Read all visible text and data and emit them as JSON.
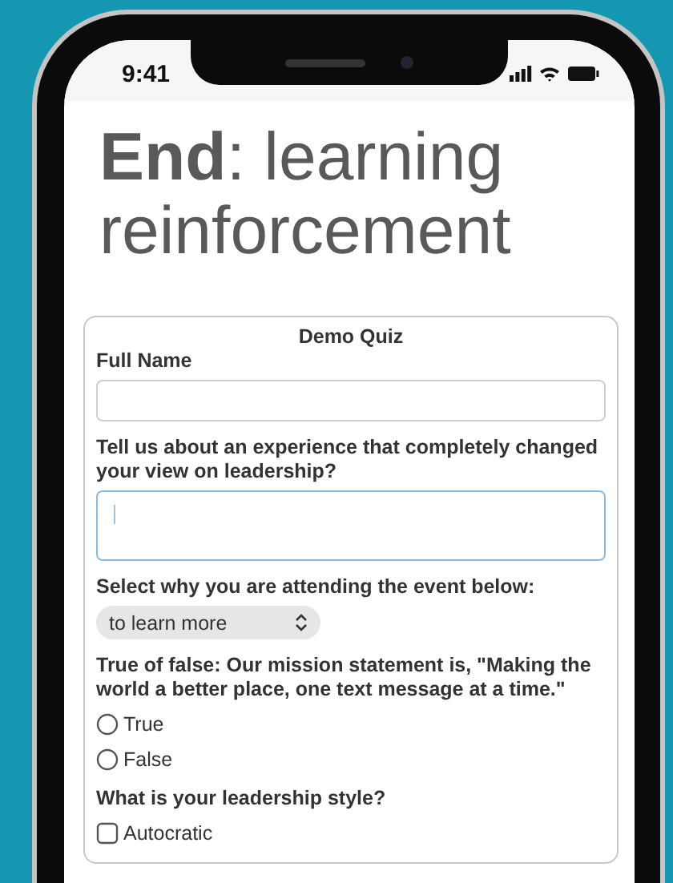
{
  "status_bar": {
    "time": "9:41"
  },
  "heading": "**End**: learning reinforcement",
  "quiz": {
    "title": "Demo Quiz",
    "fields": [
      {
        "kind": "text",
        "label": "Full Name",
        "focused": false
      },
      {
        "kind": "textarea",
        "label": "Tell us about an experience that completely changed your view on leadership?",
        "focused": true
      },
      {
        "kind": "select",
        "label": "Select why you are attending the event below:",
        "value": "to learn more"
      },
      {
        "kind": "radio",
        "label": "True of false: Our mission statement is, \"Making the world a better place, one text message at a time.\"",
        "options": [
          {
            "label": "True",
            "selected": false
          },
          {
            "label": "False",
            "selected": false
          }
        ]
      },
      {
        "kind": "checkbox",
        "label": "What is your leadership style?",
        "options": [
          {
            "label": "Autocratic",
            "checked": false
          }
        ]
      }
    ]
  }
}
